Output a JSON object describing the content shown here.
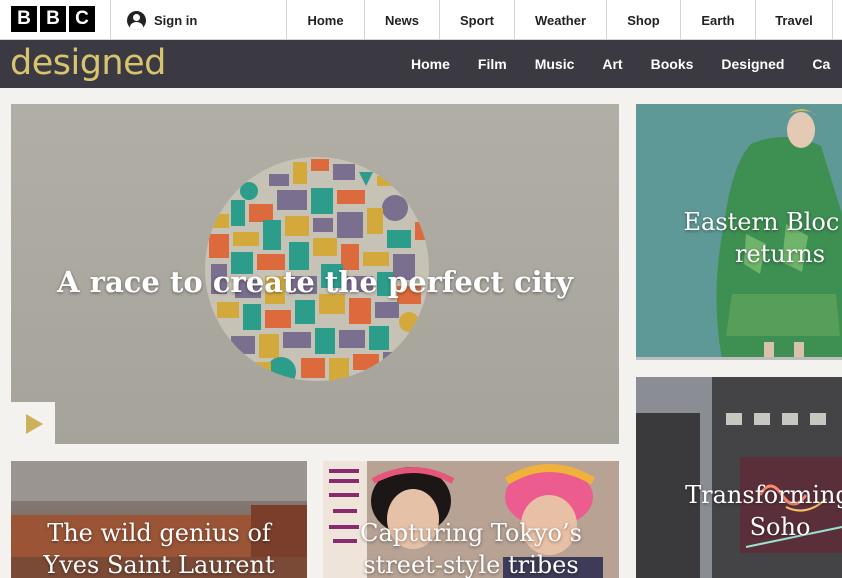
{
  "global_header": {
    "logo_letters": [
      "B",
      "B",
      "C"
    ],
    "signin_label": "Sign in",
    "signin_icon": "user-icon",
    "nav": [
      "Home",
      "News",
      "Sport",
      "Weather",
      "Shop",
      "Earth",
      "Travel"
    ]
  },
  "brand": {
    "logo_text": "designed",
    "logo_color": "#d8c36f",
    "bar_color": "#3b3a42",
    "nav": [
      "Home",
      "Film",
      "Music",
      "Art",
      "Books",
      "Designed",
      "Ca"
    ]
  },
  "stories": {
    "hero": {
      "title": "A race to create the perfect city",
      "play_icon": "play-icon"
    },
    "eastern": {
      "line1": "Eastern Bloc de",
      "line2": "returns"
    },
    "soho": {
      "line1": "Transforming S",
      "line2": "Soho"
    },
    "ysl": {
      "line1": "The wild genius of",
      "line2": "Yves Saint Laurent"
    },
    "tokyo": {
      "line1": "Capturing Tokyo’s",
      "line2": "street-style tribes"
    }
  }
}
